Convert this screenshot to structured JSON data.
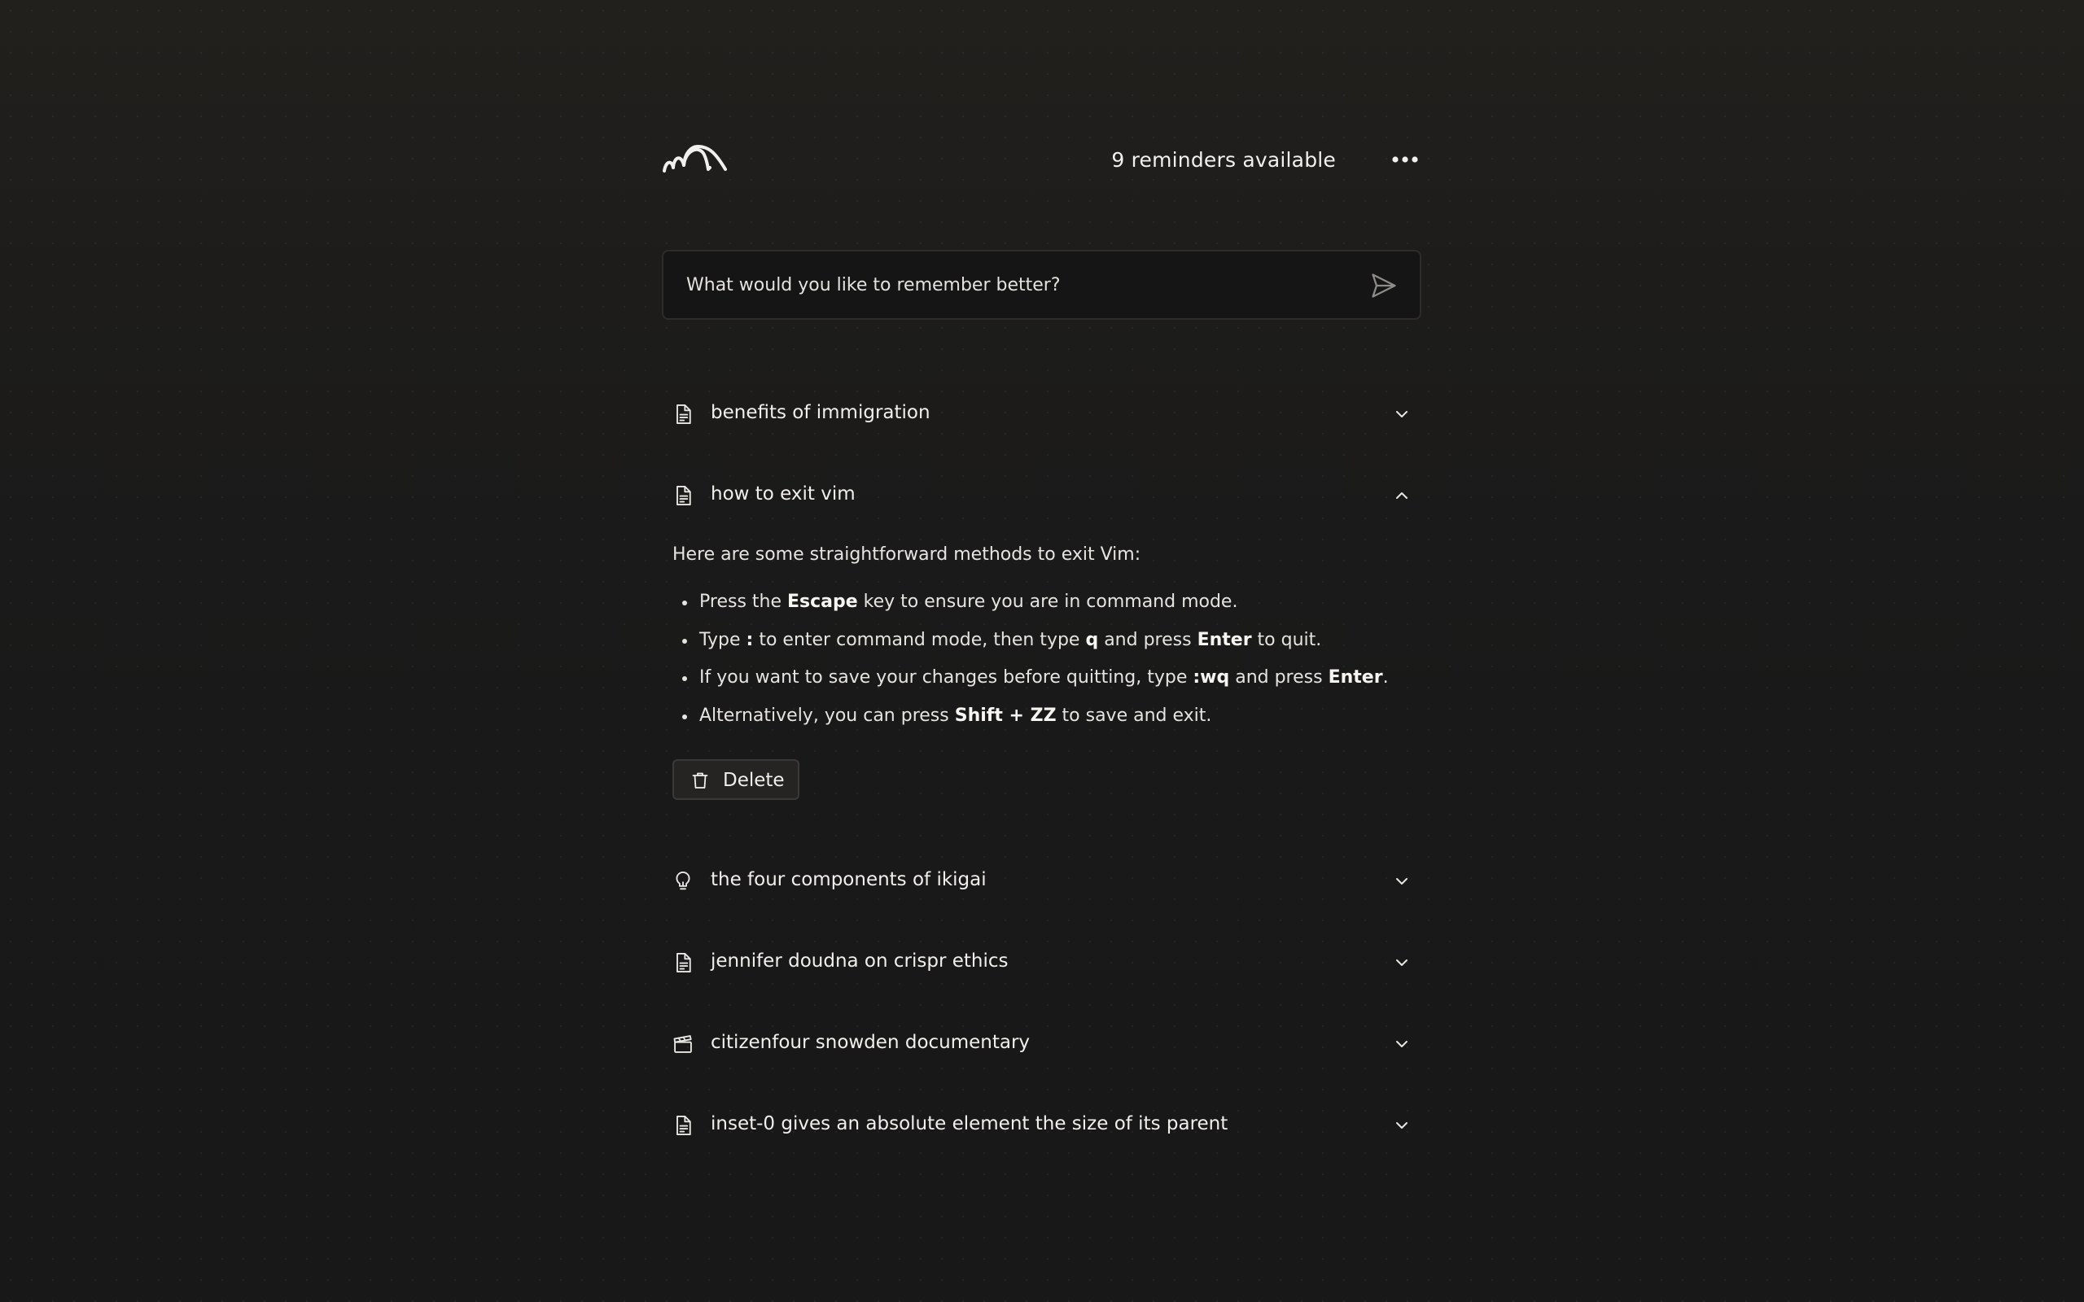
{
  "header": {
    "reminders_text": "9 reminders available",
    "logo_icon": "wave-logo-icon",
    "more_icon": "more-dots-icon"
  },
  "search": {
    "placeholder": "What would you like to remember better?",
    "value": "",
    "send_icon": "send-icon"
  },
  "items": [
    {
      "title": "benefits of immigration",
      "icon": "document-icon",
      "expanded": false
    },
    {
      "title": "how to exit vim",
      "icon": "document-icon",
      "expanded": true
    },
    {
      "title": "the four components of ikigai",
      "icon": "lightbulb-icon",
      "expanded": false
    },
    {
      "title": "jennifer doudna on crispr ethics",
      "icon": "document-icon",
      "expanded": false
    },
    {
      "title": "citizenfour snowden documentary",
      "icon": "clapperboard-icon",
      "expanded": false
    },
    {
      "title": "inset-0 gives an absolute element the size of its parent",
      "icon": "document-icon",
      "expanded": false
    }
  ],
  "expanded_content": {
    "intro": "Here are some straightforward methods to exit Vim:",
    "bullets": [
      {
        "t1": "Press the ",
        "b1": "Escape",
        "t2": " key to ensure you are in command mode."
      },
      {
        "t1": "Type ",
        "b1": ":",
        "t2": " to enter command mode, then type ",
        "b2": "q",
        "t3": " and press ",
        "b3": "Enter",
        "t4": " to quit."
      },
      {
        "t1": "If you want to save your changes before quitting, type ",
        "b1": ":wq",
        "t2": " and press ",
        "b2": "Enter",
        "t3": "."
      },
      {
        "t1": "Alternatively, you can press ",
        "b1": "Shift + ZZ",
        "t2": " to save and exit."
      }
    ],
    "delete_label": "Delete",
    "delete_icon": "trash-icon"
  },
  "colors": {
    "background": "#191919",
    "text": "#e9e7e3",
    "input_border": "#2d2c2b",
    "button_bg": "#252423"
  }
}
